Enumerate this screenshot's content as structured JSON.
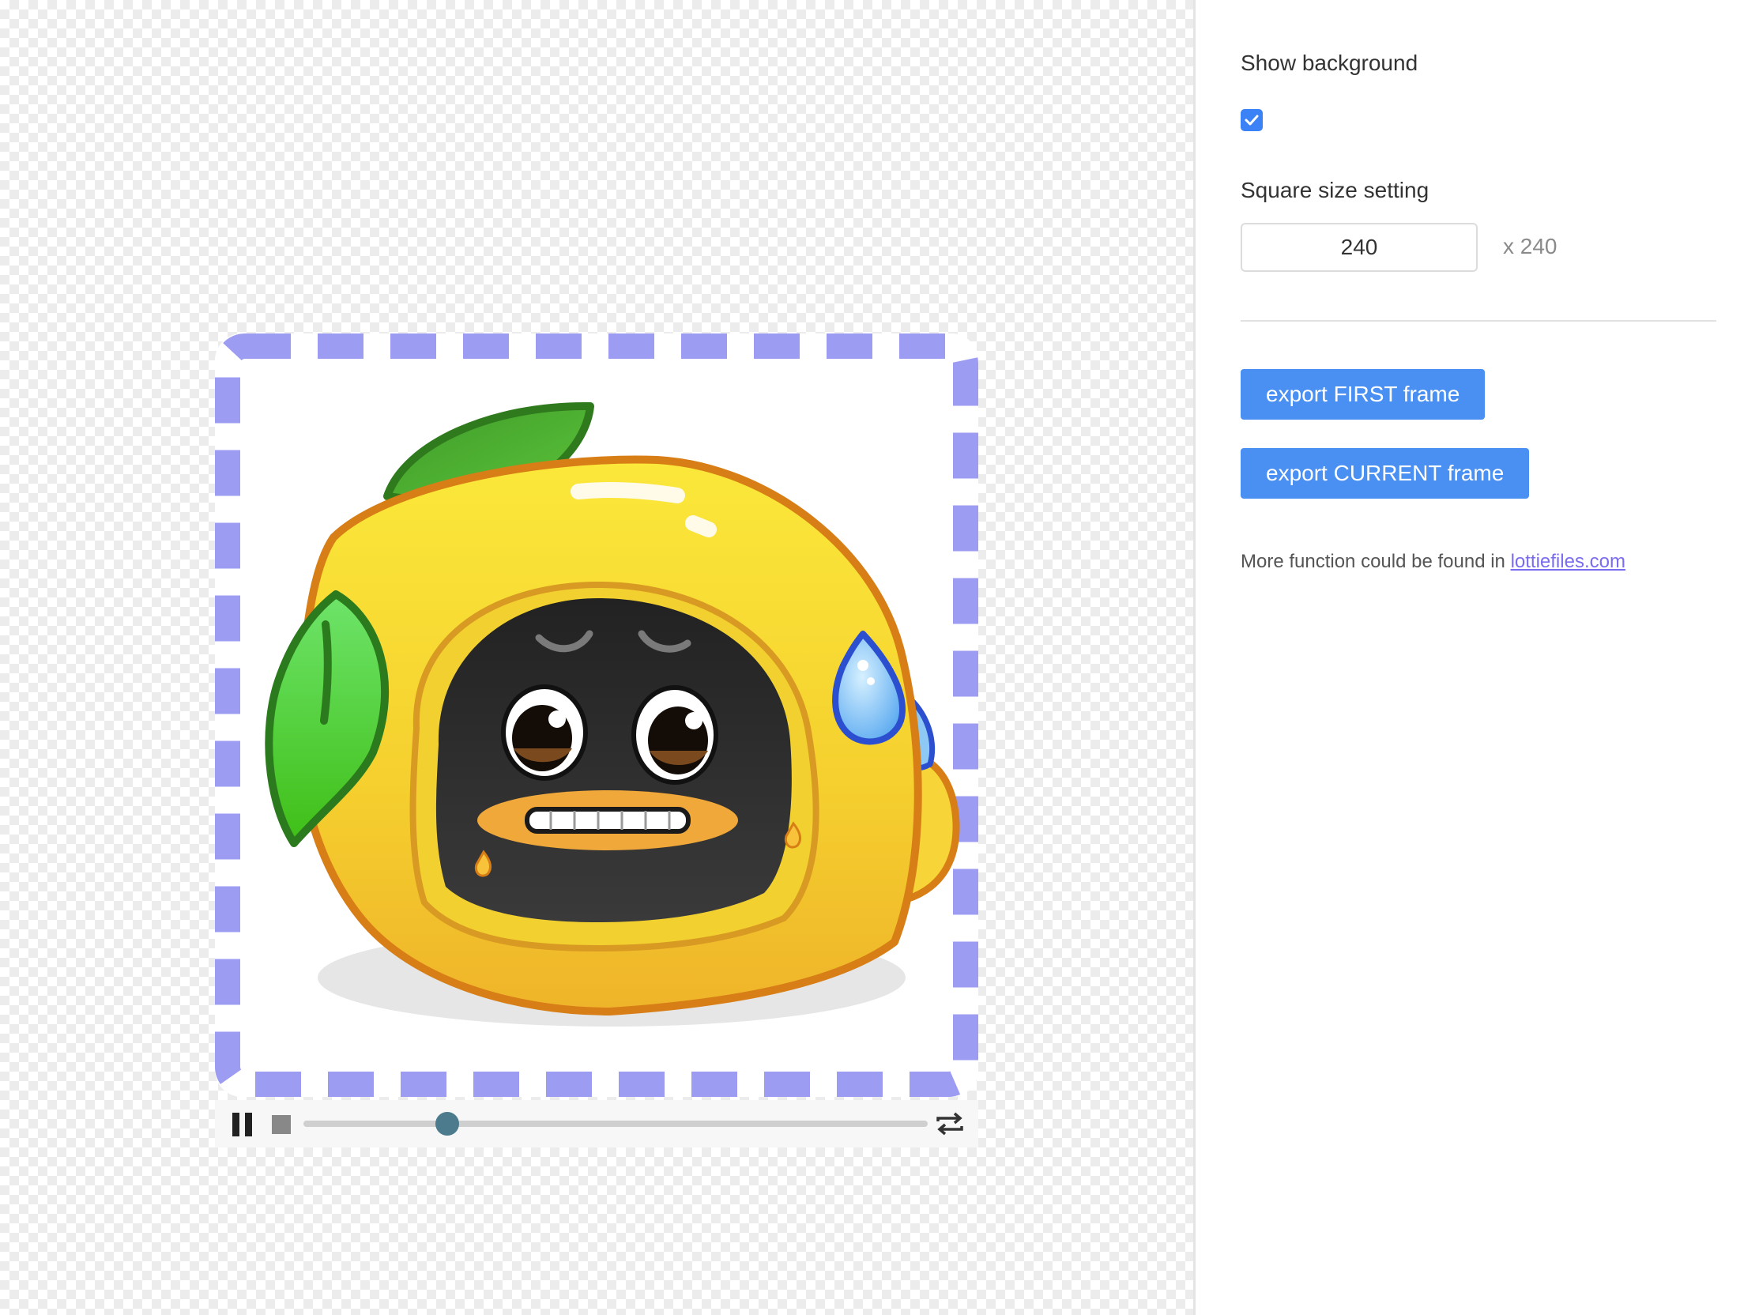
{
  "settings": {
    "show_background_label": "Show background",
    "show_background_checked": true,
    "square_size_label": "Square size setting",
    "size_value": "240",
    "size_suffix": "x 240",
    "export_first_label": "export FIRST frame",
    "export_current_label": "export CURRENT frame",
    "more_text": "More function could be found in",
    "more_link": "lottiefiles.com"
  },
  "player": {
    "progress": 0.23,
    "frame_border_color": "#9c9cf2",
    "animation": "lemon-character-sweating"
  },
  "colors": {
    "accent": "#4a90f2",
    "link": "#7a6cf0",
    "seek_thumb": "#4b7b8c"
  }
}
